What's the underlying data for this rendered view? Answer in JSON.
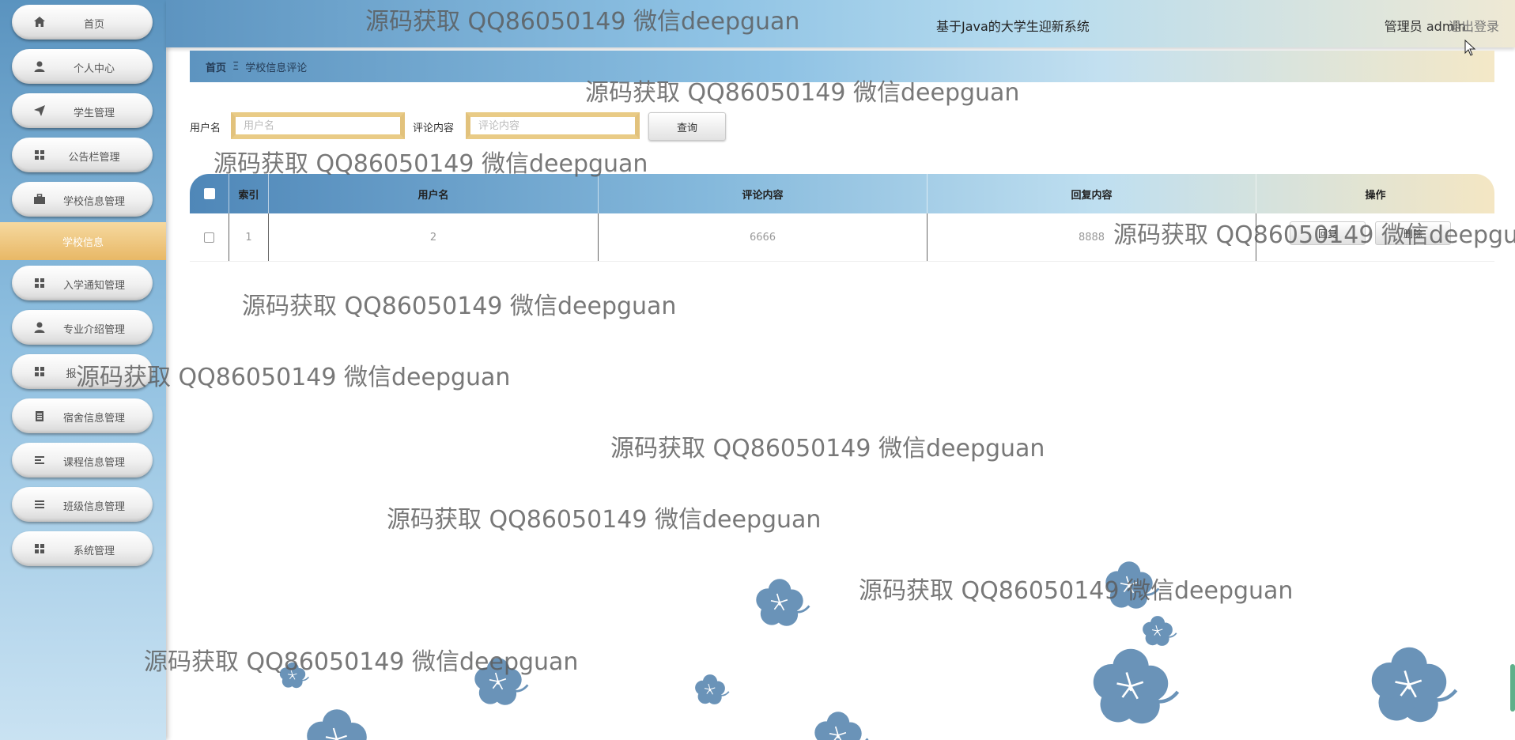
{
  "header": {
    "title": "基于Java的大学生迎新系统",
    "user": "管理员 admin",
    "logout": "退出登录"
  },
  "sidebar": {
    "items": [
      {
        "label": "首页",
        "icon": "home-icon"
      },
      {
        "label": "个人中心",
        "icon": "user-icon"
      },
      {
        "label": "学生管理",
        "icon": "send-icon"
      },
      {
        "label": "公告栏管理",
        "icon": "grid-icon"
      },
      {
        "label": "学校信息管理",
        "icon": "briefcase-icon"
      },
      {
        "label": "入学通知管理",
        "icon": "grid-icon"
      },
      {
        "label": "专业介绍管理",
        "icon": "user-icon"
      },
      {
        "label": "报",
        "icon": "grid-icon"
      },
      {
        "label": "宿舍信息管理",
        "icon": "clipboard-icon"
      },
      {
        "label": "课程信息管理",
        "icon": "list-icon"
      },
      {
        "label": "班级信息管理",
        "icon": "list-icon"
      },
      {
        "label": "系统管理",
        "icon": "grid-icon"
      }
    ],
    "active_sub": "学校信息"
  },
  "breadcrumb": {
    "home": "首页",
    "separator": "Ξ",
    "current": "学校信息评论"
  },
  "search": {
    "username_label": "用户名",
    "username_placeholder": "用户名",
    "content_label": "评论内容",
    "content_placeholder": "评论内容",
    "query_button": "查询"
  },
  "table": {
    "headers": [
      "索引",
      "用户名",
      "评论内容",
      "回复内容",
      "操作"
    ],
    "rows": [
      {
        "index": "1",
        "username": "2",
        "comment": "6666",
        "reply": "8888",
        "actions": [
          "回复",
          "删除"
        ]
      }
    ]
  },
  "watermark": "源码获取 QQ86050149 微信deepguan",
  "colors": {
    "sidebar_top": "#5a93bf",
    "active_item": "#e8b866",
    "flower": "#6a93b8",
    "input_border": "#e9cb86"
  }
}
